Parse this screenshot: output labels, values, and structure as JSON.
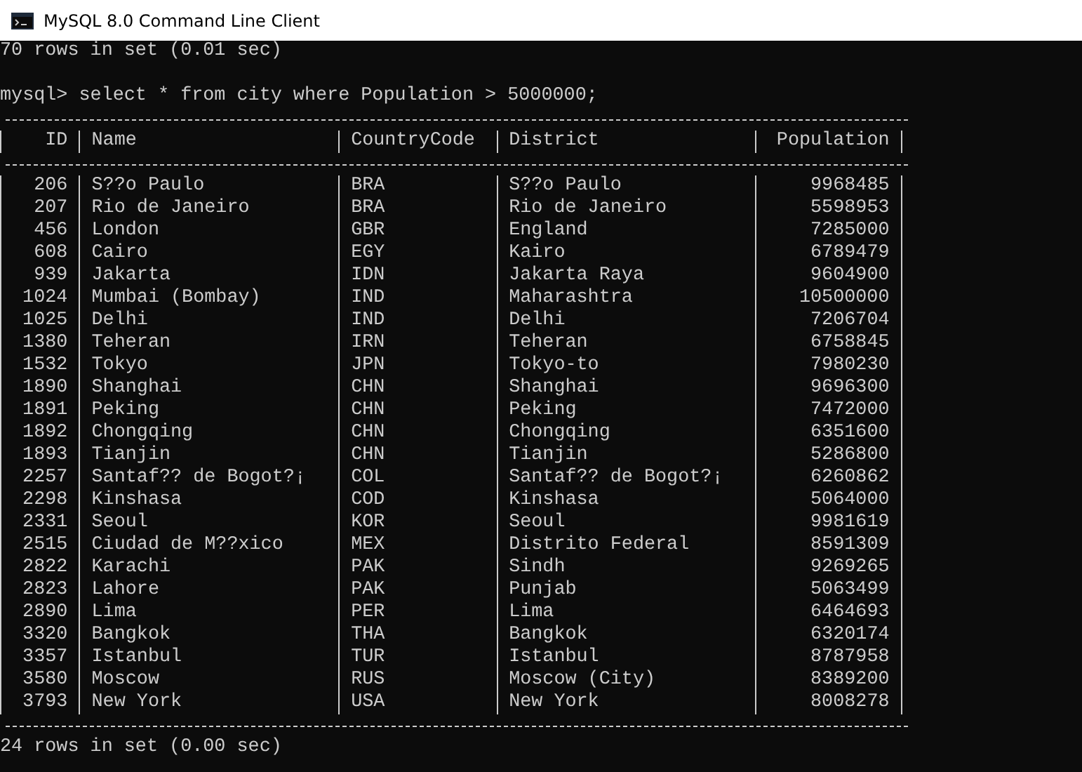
{
  "window": {
    "title": "MySQL 8.0 Command Line Client"
  },
  "console": {
    "previous_result": "70 rows in set (0.01 sec)",
    "prompt": "mysql>",
    "command": "select * from city where Population > 5000000;"
  },
  "table": {
    "columns": [
      {
        "label": "ID",
        "kind": "number"
      },
      {
        "label": "Name",
        "kind": "text"
      },
      {
        "label": "CountryCode",
        "kind": "text"
      },
      {
        "label": "District",
        "kind": "text"
      },
      {
        "label": "Population",
        "kind": "number"
      }
    ],
    "rows": [
      [
        "206",
        "S??o Paulo",
        "BRA",
        "S??o Paulo",
        "9968485"
      ],
      [
        "207",
        "Rio de Janeiro",
        "BRA",
        "Rio de Janeiro",
        "5598953"
      ],
      [
        "456",
        "London",
        "GBR",
        "England",
        "7285000"
      ],
      [
        "608",
        "Cairo",
        "EGY",
        "Kairo",
        "6789479"
      ],
      [
        "939",
        "Jakarta",
        "IDN",
        "Jakarta Raya",
        "9604900"
      ],
      [
        "1024",
        "Mumbai (Bombay)",
        "IND",
        "Maharashtra",
        "10500000"
      ],
      [
        "1025",
        "Delhi",
        "IND",
        "Delhi",
        "7206704"
      ],
      [
        "1380",
        "Teheran",
        "IRN",
        "Teheran",
        "6758845"
      ],
      [
        "1532",
        "Tokyo",
        "JPN",
        "Tokyo-to",
        "7980230"
      ],
      [
        "1890",
        "Shanghai",
        "CHN",
        "Shanghai",
        "9696300"
      ],
      [
        "1891",
        "Peking",
        "CHN",
        "Peking",
        "7472000"
      ],
      [
        "1892",
        "Chongqing",
        "CHN",
        "Chongqing",
        "6351600"
      ],
      [
        "1893",
        "Tianjin",
        "CHN",
        "Tianjin",
        "5286800"
      ],
      [
        "2257",
        "Santaf?? de Bogot?¡",
        "COL",
        "Santaf?? de Bogot?¡",
        "6260862"
      ],
      [
        "2298",
        "Kinshasa",
        "COD",
        "Kinshasa",
        "5064000"
      ],
      [
        "2331",
        "Seoul",
        "KOR",
        "Seoul",
        "9981619"
      ],
      [
        "2515",
        "Ciudad de M??xico",
        "MEX",
        "Distrito Federal",
        "8591309"
      ],
      [
        "2822",
        "Karachi",
        "PAK",
        "Sindh",
        "9269265"
      ],
      [
        "2823",
        "Lahore",
        "PAK",
        "Punjab",
        "5063499"
      ],
      [
        "2890",
        "Lima",
        "PER",
        "Lima",
        "6464693"
      ],
      [
        "3320",
        "Bangkok",
        "THA",
        "Bangkok",
        "6320174"
      ],
      [
        "3357",
        "Istanbul",
        "TUR",
        "Istanbul",
        "8787958"
      ],
      [
        "3580",
        "Moscow",
        "RUS",
        "Moscow (City)",
        "8389200"
      ],
      [
        "3793",
        "New York",
        "USA",
        "New York",
        "8008278"
      ]
    ]
  },
  "result": "24 rows in set (0.00 sec)"
}
